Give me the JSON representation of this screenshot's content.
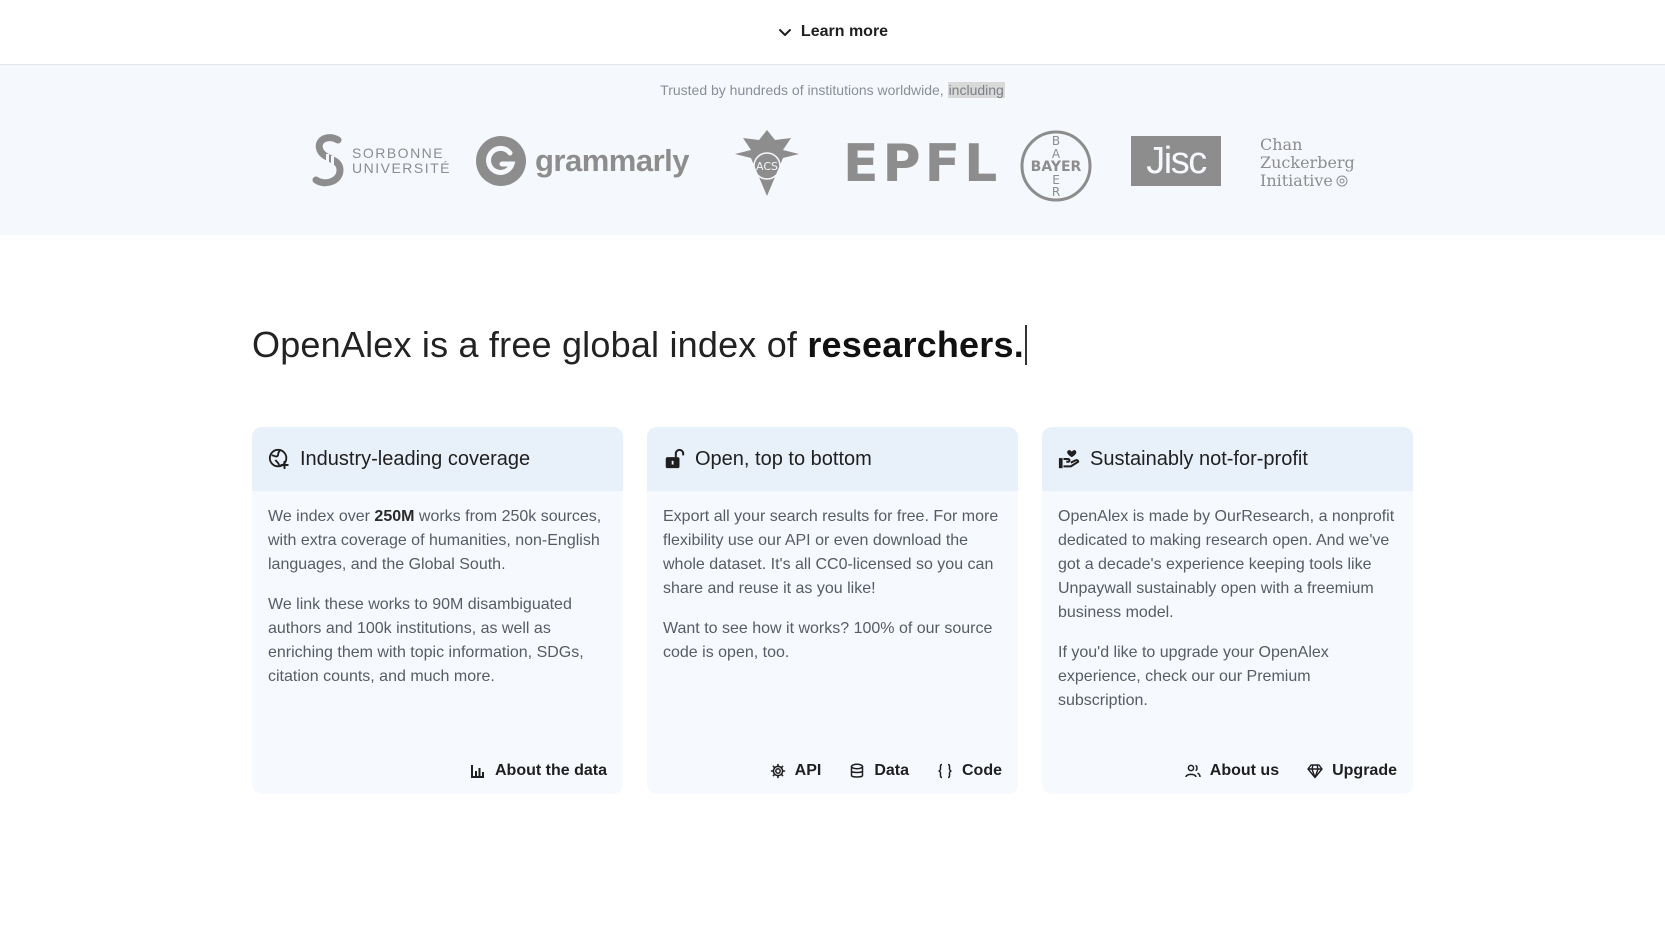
{
  "topbar": {
    "learn_more_label": "Learn more"
  },
  "trusted": {
    "text_prefix": "Trusted by hundreds of institutions worldwide, ",
    "text_highlight": "including",
    "logos": {
      "sorbonne": {
        "line1": "SORBONNE",
        "line2": "UNIVERSITÉ"
      },
      "grammarly": {
        "word": "grammarly"
      },
      "acs": {
        "letters": "ACS"
      },
      "epfl": {
        "word": "EPFL"
      },
      "bayer": {
        "word": "BAYER"
      },
      "jisc": {
        "word": "Jisc"
      },
      "czi": {
        "line1": "Chan",
        "line2": "Zuckerberg",
        "line3": "Initiative"
      }
    }
  },
  "headline": {
    "prefix": "OpenAlex is a free global index of ",
    "emphasis": "researchers."
  },
  "cards": [
    {
      "title": "Industry-leading coverage",
      "icon": "globe-icon",
      "p1_a": "We index over ",
      "p1_b": "250M",
      "p1_c": " works from 250k sources, with extra coverage of humanities, non-English languages, and the Global South.",
      "p2": "We link these works to 90M disambiguated authors and 100k institutions, as well as enriching them with topic information, SDGs, citation counts, and much more.",
      "actions": [
        {
          "label": "About the data",
          "icon": "bar-chart-icon"
        }
      ]
    },
    {
      "title": "Open, top to bottom",
      "icon": "unlock-icon",
      "p1": "Export all your search results for free. For more flexibility use our API or even download the whole dataset. It's all CC0-licensed so you can share and reuse it as you like!",
      "p2": "Want to see how it works? 100% of our source code is open, too.",
      "actions": [
        {
          "label": "API",
          "icon": "gear-icon"
        },
        {
          "label": "Data",
          "icon": "database-icon"
        },
        {
          "label": "Code",
          "icon": "braces-icon"
        }
      ]
    },
    {
      "title": "Sustainably not-for-profit",
      "icon": "hand-heart-icon",
      "p1": "OpenAlex is made by OurResearch, a nonprofit dedicated to making research open. And we've got a decade's experience keeping tools like Unpaywall sustainably open with a freemium business model.",
      "p2": "If you'd like to upgrade your OpenAlex experience, check our our Premium subscription.",
      "actions": [
        {
          "label": "About us",
          "icon": "people-icon"
        },
        {
          "label": "Upgrade",
          "icon": "diamond-icon"
        }
      ]
    }
  ]
}
